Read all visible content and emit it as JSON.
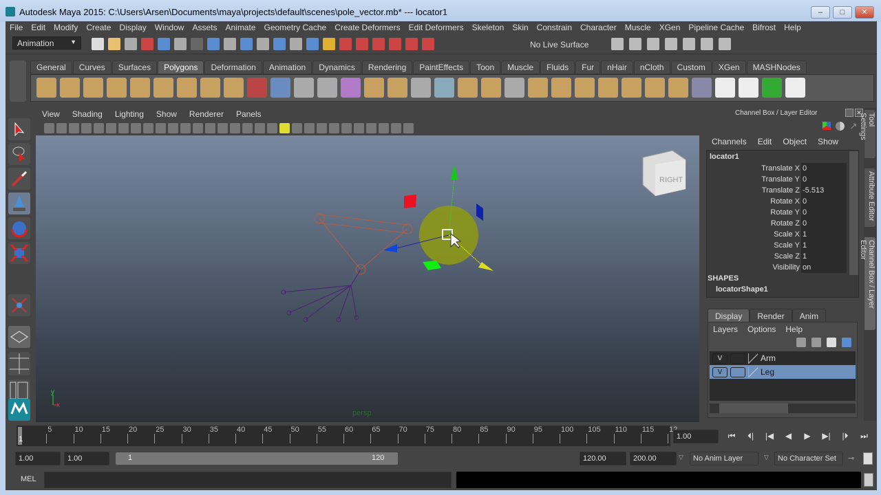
{
  "title": "Autodesk Maya 2015: C:\\Users\\Arsen\\Documents\\maya\\projects\\default\\scenes\\pole_vector.mb*   ---   locator1",
  "window_buttons": {
    "minimize": "–",
    "maximize": "□",
    "close": "✕"
  },
  "menus": [
    "File",
    "Edit",
    "Modify",
    "Create",
    "Display",
    "Window",
    "Assets",
    "Animate",
    "Geometry Cache",
    "Create Deformers",
    "Edit Deformers",
    "Skeleton",
    "Skin",
    "Constrain",
    "Character",
    "Muscle",
    "XGen",
    "Pipeline Cache",
    "Bifrost",
    "Help"
  ],
  "menu_set": "Animation",
  "live_surface": "No Live Surface",
  "shelf_tabs": [
    "General",
    "Curves",
    "Surfaces",
    "Polygons",
    "Deformation",
    "Animation",
    "Dynamics",
    "Rendering",
    "PaintEffects",
    "Toon",
    "Muscle",
    "Fluids",
    "Fur",
    "nHair",
    "nCloth",
    "Custom",
    "XGen",
    "MASHNodes"
  ],
  "active_shelf_tab": "Polygons",
  "shelf_icons": [
    "sphere",
    "cube",
    "cylinder",
    "cone",
    "plane",
    "torus",
    "pyramid",
    "pipe",
    "soccer-ball",
    "combine",
    "separate",
    "extract",
    "smooth",
    "mirror",
    "boolean",
    "bevel",
    "bridge",
    "append",
    "extrude",
    "merge",
    "split",
    "insert-edge-loop",
    "offset-edge-loop",
    "fill-hole",
    "triangulate",
    "quadrangulate",
    "reduce",
    "sculpt",
    "checker-uv",
    "checker-a",
    "checker-b",
    "uv-editor",
    "checker-c"
  ],
  "panel_menus": [
    "View",
    "Shading",
    "Lighting",
    "Show",
    "Renderer",
    "Panels"
  ],
  "viewport": {
    "camera": "persp",
    "view_cube": "RIGHT",
    "axis_y": "y",
    "axis_x": "x"
  },
  "channel_box": {
    "title": "Channel Box / Layer Editor",
    "menus": [
      "Channels",
      "Edit",
      "Object",
      "Show"
    ],
    "object": "locator1",
    "channels": [
      {
        "name": "Translate X",
        "value": "0"
      },
      {
        "name": "Translate Y",
        "value": "0"
      },
      {
        "name": "Translate Z",
        "value": "-5.513"
      },
      {
        "name": "Rotate X",
        "value": "0"
      },
      {
        "name": "Rotate Y",
        "value": "0"
      },
      {
        "name": "Rotate Z",
        "value": "0"
      },
      {
        "name": "Scale X",
        "value": "1"
      },
      {
        "name": "Scale Y",
        "value": "1"
      },
      {
        "name": "Scale Z",
        "value": "1"
      },
      {
        "name": "Visibility",
        "value": "on"
      }
    ],
    "shapes_label": "SHAPES",
    "shape": "locatorShape1"
  },
  "layer_editor": {
    "tabs": [
      "Display",
      "Render",
      "Anim"
    ],
    "menus": [
      "Layers",
      "Options",
      "Help"
    ],
    "layers": [
      {
        "v": "V",
        "name": "Arm",
        "selected": false
      },
      {
        "v": "V",
        "name": "Leg",
        "selected": true
      }
    ]
  },
  "side_tabs": [
    "Tool Settings",
    "Attribute Editor",
    "Channel Box / Layer Editor"
  ],
  "timeline": {
    "ticks": [
      "5",
      "10",
      "15",
      "20",
      "25",
      "30",
      "35",
      "40",
      "45",
      "50",
      "55",
      "60",
      "65",
      "70",
      "75",
      "80",
      "85",
      "90",
      "95",
      "100",
      "105",
      "110",
      "115",
      "12"
    ],
    "current_frame_marker": "1",
    "current_time": "1.00"
  },
  "range": {
    "start": "1.00",
    "anim_start": "1.00",
    "range_start": "1",
    "range_end": "120",
    "anim_end": "120.00",
    "end": "200.00",
    "anim_layer": "No Anim Layer",
    "character_set": "No Character Set"
  },
  "command_line": {
    "label": "MEL"
  }
}
